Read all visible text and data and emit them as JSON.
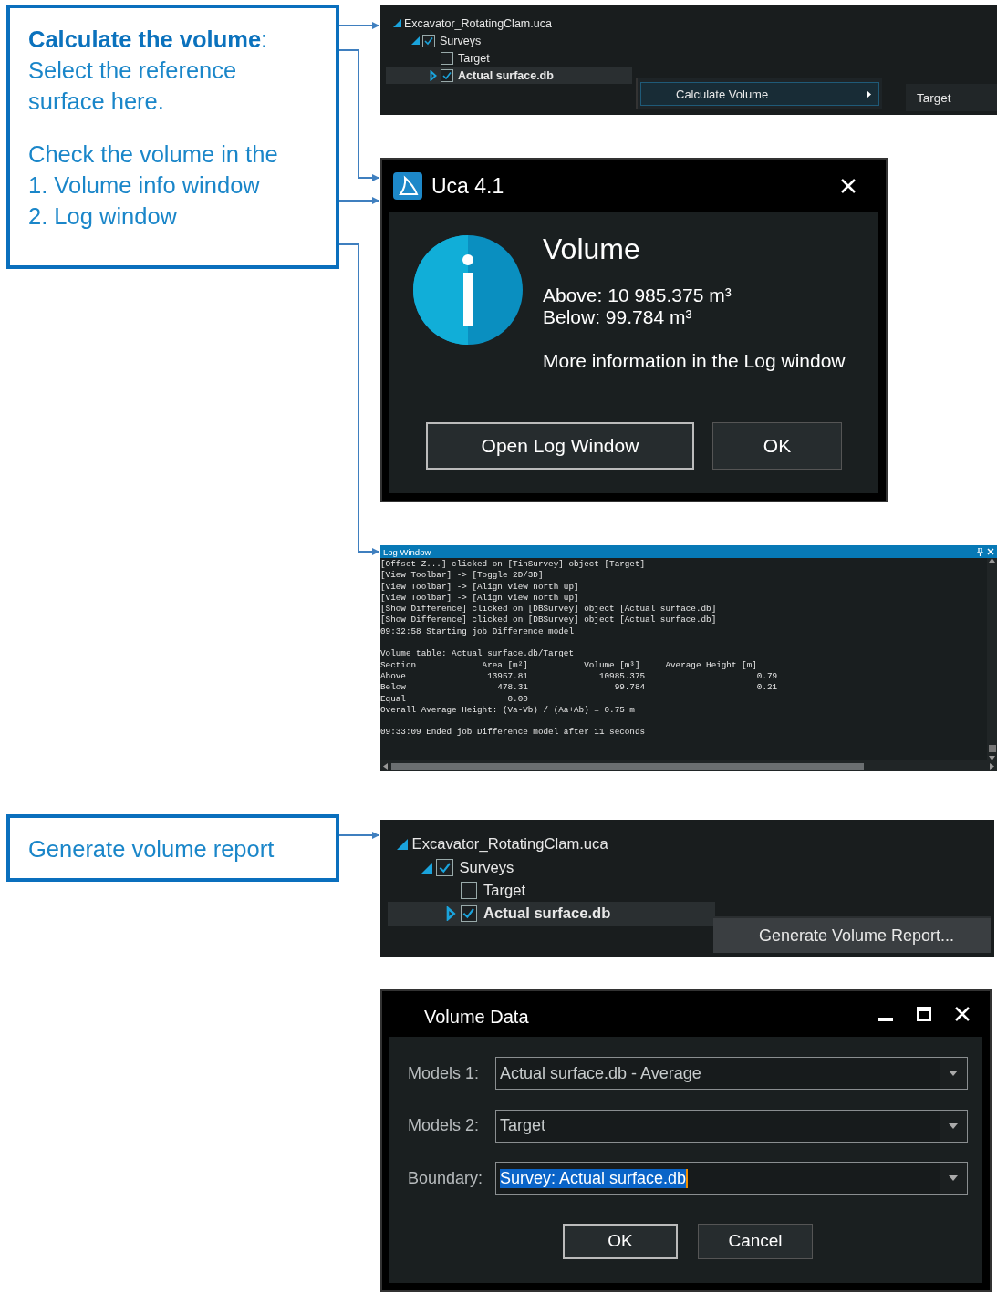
{
  "callouts": [
    {
      "paragraphs": [
        [
          "**Calculate the volume**:",
          "Select the reference surface here."
        ],
        [
          "Check the volume in the",
          "1. Volume info window",
          "2. Log window"
        ]
      ]
    },
    {
      "paragraphs": [
        [
          "Generate volume report"
        ]
      ]
    }
  ],
  "tree_top": {
    "items": [
      {
        "label": "Excavator_RotatingClam.uca",
        "expanded": true,
        "selected": false,
        "children": [
          {
            "label": "Surveys",
            "checked": true,
            "expanded": true,
            "selected": false,
            "children": [
              {
                "label": "Target",
                "checked": false,
                "selected": false
              },
              {
                "label": "Actual surface.db",
                "checked": true,
                "expanded": false,
                "selected": true
              }
            ]
          }
        ]
      }
    ],
    "menu": [
      {
        "label": "Calculate Volume",
        "has_submenu": true,
        "selected": true
      }
    ],
    "submenu": [
      {
        "label": "Target",
        "selected": false
      }
    ]
  },
  "info_dialog": {
    "title": "Uca 4.1",
    "heading": "Volume",
    "lines": [
      "Above: 10 985.375 m³",
      "Below: 99.784 m³"
    ],
    "note": "More information in the Log window",
    "buttons": [
      {
        "label": "Open Log Window",
        "default": true
      },
      {
        "label": "OK",
        "default": false
      }
    ]
  },
  "log_window": {
    "title": "Log Window",
    "blocks": [
      [
        "[Offset Z...] clicked on [TinSurvey] object [Target]",
        "[View Toolbar] -> [Toggle 2D/3D]",
        "[View Toolbar] -> [Align view north up]",
        "[View Toolbar] -> [Align view north up]",
        "[Show Difference] clicked on [DBSurvey] object [Actual surface.db]",
        "[Show Difference] clicked on [DBSurvey] object [Actual surface.db]",
        "09:32:58 Starting job Difference model"
      ],
      [
        "Volume table: Actual surface.db/Target",
        "Section             Area [m²]           Volume [m³]     Average Height [m]",
        "Above                13957.81              10985.375                      0.79",
        "Below                  478.31                 99.784                      0.21",
        "Equal                    0.00",
        "Overall Average Height: (Va-Vb) / (Aa+Ab) = 0.75 m"
      ],
      [
        "09:33:09 Ended job Difference model after 11 seconds"
      ]
    ]
  },
  "tree_bottom": {
    "items": [
      {
        "label": "Excavator_RotatingClam.uca",
        "expanded": true,
        "selected": false,
        "children": [
          {
            "label": "Surveys",
            "checked": true,
            "expanded": true,
            "selected": false,
            "children": [
              {
                "label": "Target",
                "checked": false,
                "selected": false
              },
              {
                "label": "Actual surface.db",
                "checked": true,
                "expanded": false,
                "selected": true
              }
            ]
          }
        ]
      }
    ],
    "menu": [
      {
        "label": "Generate Volume Report...",
        "has_submenu": false,
        "selected": false
      }
    ]
  },
  "volume_dialog": {
    "title": "Volume Data",
    "fields": [
      {
        "label": "Models 1:",
        "value": "Actual surface.db - Average",
        "text_selected": false
      },
      {
        "label": "Models 2:",
        "value": "Target",
        "text_selected": false
      },
      {
        "label": "Boundary:",
        "value": "Survey: Actual surface.db",
        "text_selected": true
      }
    ],
    "buttons": [
      {
        "label": "OK",
        "default": true
      },
      {
        "label": "Cancel",
        "default": false
      }
    ]
  }
}
